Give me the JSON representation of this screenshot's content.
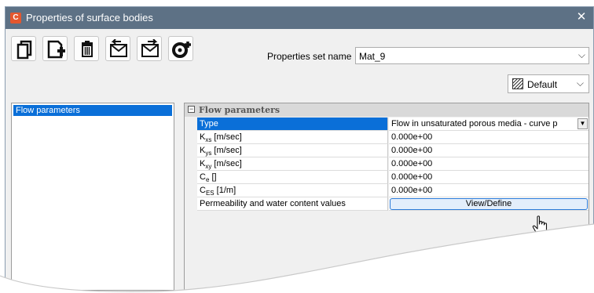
{
  "window": {
    "title": "Properties of surface bodies",
    "app_icon": "C",
    "close_glyph": "✕"
  },
  "toolbar": {
    "buttons": [
      {
        "name": "copy-icon"
      },
      {
        "name": "add-icon"
      },
      {
        "name": "delete-icon"
      },
      {
        "name": "import-icon"
      },
      {
        "name": "export-icon"
      },
      {
        "name": "add-set-icon"
      }
    ]
  },
  "properties_set": {
    "label": "Properties set name",
    "value": "Mat_9"
  },
  "style_select": {
    "value": "Default"
  },
  "left_list": {
    "items": [
      "Flow parameters"
    ]
  },
  "grid": {
    "category": "Flow parameters",
    "toggle": "−",
    "rows": [
      {
        "name_main": "Type",
        "name_sub": "",
        "name_tail": "",
        "value": "Flow in unsaturated porous media - curve p"
      },
      {
        "name_main": "K",
        "name_sub": "xs",
        "name_tail": " [m/sec]",
        "value": "0.000e+00"
      },
      {
        "name_main": "K",
        "name_sub": "ys",
        "name_tail": " [m/sec]",
        "value": "0.000e+00"
      },
      {
        "name_main": "K",
        "name_sub": "xy",
        "name_tail": " [m/sec]",
        "value": "0.000e+00"
      },
      {
        "name_main": "C",
        "name_sub": "e",
        "name_tail": " []",
        "value": "0.000e+00"
      },
      {
        "name_main": "C",
        "name_sub": "ES",
        "name_tail": " [1/m]",
        "value": "0.000e+00"
      },
      {
        "name_main": "Permeability and water content values",
        "name_sub": "",
        "name_tail": "",
        "value": ""
      }
    ],
    "define_button": "View/Define"
  }
}
